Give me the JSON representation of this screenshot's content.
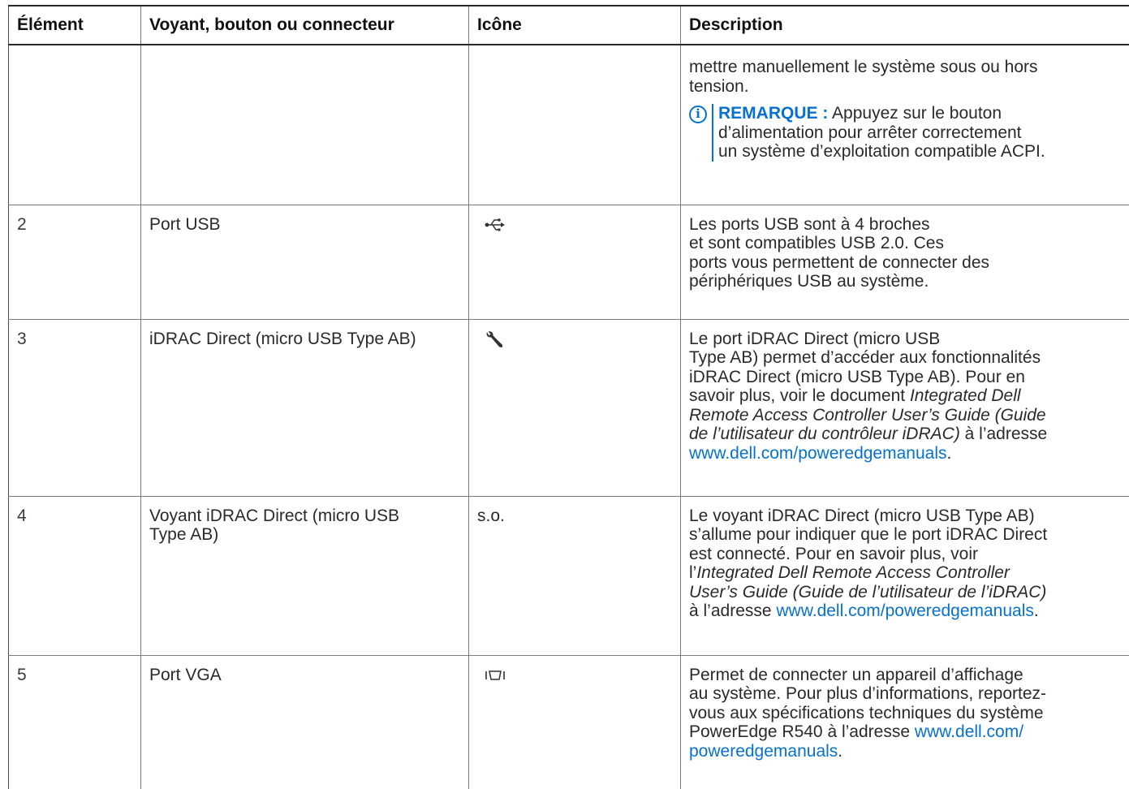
{
  "table": {
    "headers": {
      "item": "Élément",
      "indicator": "Voyant, bouton ou connecteur",
      "icon": "Icône",
      "description": "Description"
    },
    "rows": [
      {
        "id": "",
        "name": "",
        "icon": "",
        "desc_lines": [
          "mettre manuellement le système sous ou hors",
          "tension."
        ],
        "note": {
          "label": "REMARQUE :",
          "lines": [
            "Appuyez sur le bouton",
            "d’alimentation pour arrêter correctement",
            "un système d’exploitation compatible ACPI."
          ]
        }
      },
      {
        "id": "2",
        "name": "Port USB",
        "icon": "usb-icon",
        "desc_lines": [
          "Les ports USB sont à 4 broches",
          "et sont compatibles USB 2.0. Ces",
          "ports vous permettent de connecter des",
          "périphériques USB au système."
        ]
      },
      {
        "id": "3",
        "name": "iDRAC Direct (micro USB Type AB)",
        "icon": "wrench-icon",
        "desc": {
          "l1": "Le port iDRAC Direct (micro USB",
          "l2": "Type AB) permet d’accéder aux fonctionnalités",
          "l3": "iDRAC Direct (micro USB Type AB). Pour en",
          "l4a": "savoir plus, voir le document ",
          "l4b": "Integrated Dell",
          "l5": "Remote Access Controller User’s Guide (Guide",
          "l6a": "de l’utilisateur du contrôleur iDRAC)",
          "l6b": " à l’adresse",
          "link": "www.dell.com/poweredgemanuals",
          "after": "."
        }
      },
      {
        "id": "4",
        "name_lines": [
          "Voyant iDRAC Direct (micro USB",
          "Type AB)"
        ],
        "icon_text": "s.o.",
        "desc": {
          "l1": "Le voyant iDRAC Direct (micro USB Type AB)",
          "l2": "s’allume pour indiquer que le port iDRAC Direct",
          "l3": "est connecté. Pour en savoir plus, voir",
          "l4a": "l’",
          "l4b": "Integrated Dell Remote Access Controller",
          "l5": "User’s Guide (Guide de l’utilisateur de l’iDRAC)",
          "l6a": "à l’adresse ",
          "link": "www.dell.com/poweredgemanuals",
          "after": "."
        }
      },
      {
        "id": "5",
        "name": "Port VGA",
        "icon": "vga-icon",
        "desc": {
          "l1": "Permet de connecter un appareil d’affichage",
          "l2": "au système. Pour plus d’informations, reportez-",
          "l3": "vous aux spécifications techniques du système",
          "l4a": "PowerEdge R540 à l’adresse ",
          "link1": "www.dell.com/",
          "link2": "poweredgemanuals",
          "after": "."
        }
      }
    ]
  },
  "colors": {
    "link": "#0672cb",
    "text": "#2a2a2a",
    "border": "#7a7a7a"
  }
}
